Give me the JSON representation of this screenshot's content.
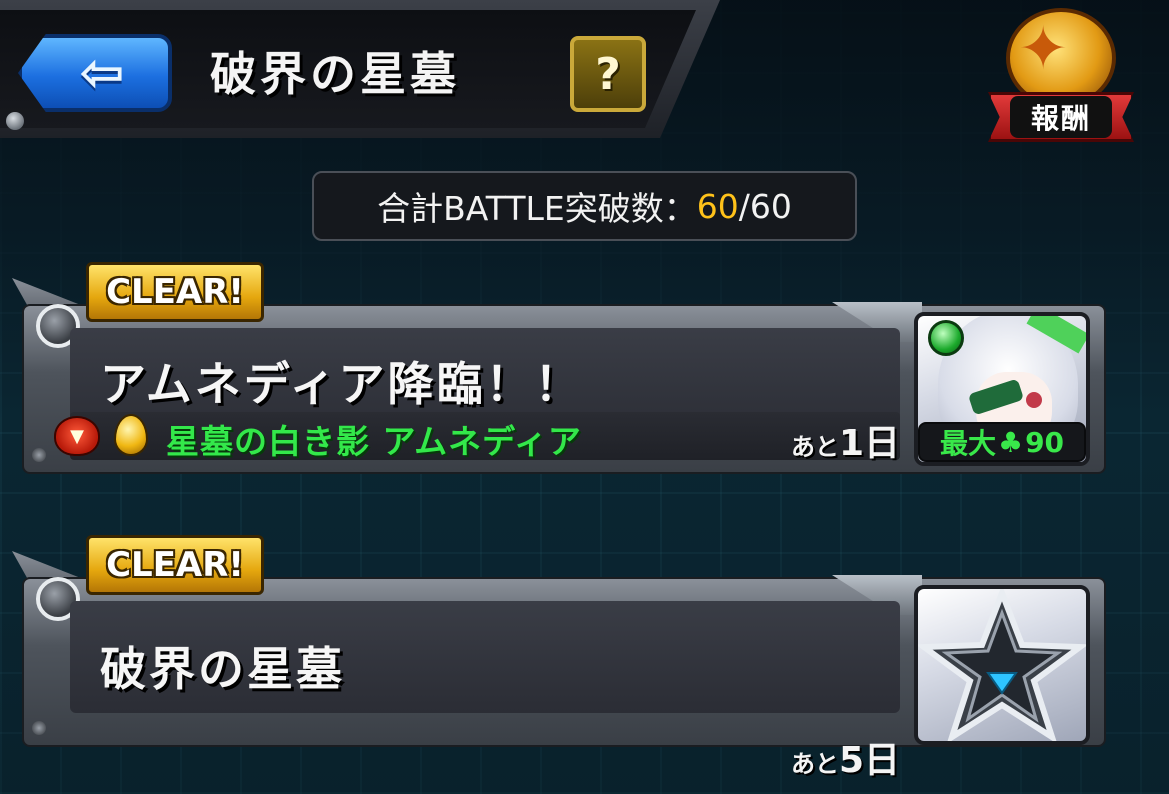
{
  "header": {
    "back_icon": "left-arrow-icon",
    "title": "破界の星墓",
    "help_label": "?"
  },
  "reward": {
    "label": "報酬",
    "icon": "dragon-medal-icon"
  },
  "summary": {
    "label": "合計BATTLE突破数：",
    "current": "60",
    "separator": "/",
    "total": "60"
  },
  "quests": [
    {
      "badge": "CLEAR!",
      "title": "アムネディア降臨！！",
      "boss_name": "星墓の白き影 アムネディア",
      "remaining_prefix": "あと",
      "remaining_days": "1日",
      "luck_label": "最大",
      "luck_value": "90",
      "icons": [
        "devil-icon",
        "egg-icon",
        "character-portrait-icon"
      ]
    },
    {
      "badge": "CLEAR!",
      "title": "破界の星墓",
      "remaining_prefix": "あと",
      "remaining_days": "5日",
      "icons": [
        "star-emblem-icon"
      ]
    }
  ],
  "colors": {
    "accent_gold": "#ffc21a",
    "boss_green": "#33e84a",
    "back_blue": "#1c6fe0"
  }
}
